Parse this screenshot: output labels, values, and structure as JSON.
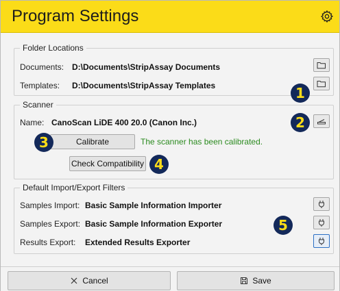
{
  "header": {
    "title": "Program Settings",
    "settings_icon": "gear-icon"
  },
  "folders": {
    "legend": "Folder Locations",
    "documents_label": "Documents:",
    "documents_value": "D:\\Documents\\StripAssay Documents",
    "templates_label": "Templates:",
    "templates_value": "D:\\Documents\\StripAssay Templates",
    "browse_icon": "folder-icon"
  },
  "scanner": {
    "legend": "Scanner",
    "name_label": "Name:",
    "name_value": "CanoScan LiDE 400 20.0 (Canon Inc.)",
    "scanner_icon": "scanner-icon",
    "calibrate_label": "Calibrate",
    "calibration_status": "The scanner has been calibrated.",
    "check_compat_label": "Check Compatibility"
  },
  "filters": {
    "legend": "Default Import/Export Filters",
    "rows": [
      {
        "label": "Samples Import:",
        "value": "Basic Sample Information Importer"
      },
      {
        "label": "Samples Export:",
        "value": "Basic Sample Information Exporter"
      },
      {
        "label": "Results Export:",
        "value": "Extended Results Exporter"
      }
    ],
    "plugin_icon": "plug-icon"
  },
  "badges": {
    "b1": "1",
    "b2": "2",
    "b3": "3",
    "b4": "4",
    "b5": "5"
  },
  "footer": {
    "cancel_label": "Cancel",
    "save_label": "Save"
  },
  "colors": {
    "header_bg": "#fbdc18",
    "badge_bg": "#13295a",
    "badge_fg": "#fbdc18",
    "status_green": "#2a8a1e",
    "focus_blue": "#2b6fc4"
  }
}
